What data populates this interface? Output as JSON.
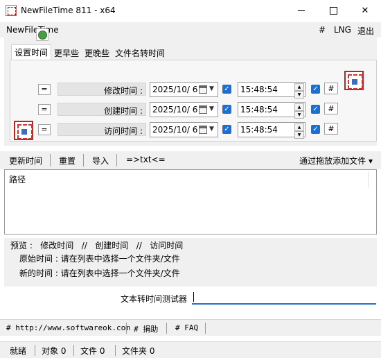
{
  "window": {
    "title": "NewFileTime 811 - x64"
  },
  "menu": {
    "app_name": "NewFileTime",
    "hash": "#",
    "lng": "LNG",
    "exit": "退出"
  },
  "tabs": [
    {
      "label": "设置时间",
      "active": true
    },
    {
      "label": "更早些",
      "active": false
    },
    {
      "label": "更晚些",
      "active": false
    },
    {
      "label": "文件名转时间",
      "active": false
    }
  ],
  "time_rows": [
    {
      "eq": "=",
      "label": "修改时间 :",
      "date": "2025/10/ 6",
      "time": "15:48:54",
      "date_checked": true,
      "time_checked": true,
      "hash": "#"
    },
    {
      "eq": "=",
      "label": "创建时间 :",
      "date": "2025/10/ 6",
      "time": "15:48:54",
      "date_checked": true,
      "time_checked": true,
      "hash": "#"
    },
    {
      "eq": "=",
      "label": "访问时间 :",
      "date": "2025/10/ 6",
      "time": "15:48:54",
      "date_checked": true,
      "time_checked": true,
      "hash": "#"
    }
  ],
  "toolbar": {
    "update": "更新时间",
    "reset": "重置",
    "import": "导入",
    "txt": "=>txt<=",
    "drag_drop": "通过拖放添加文件"
  },
  "list": {
    "header": "路径"
  },
  "preview": {
    "header": "预览 :   修改时间   //   创建时间   //   访问时间",
    "original": "原始时间 : 请在列表中选择一个文件夹/文件",
    "new": "新的时间 : 请在列表中选择一个文件夹/文件"
  },
  "tester": {
    "label": "文本转时间测试器",
    "value": ""
  },
  "links": {
    "site": "# http://www.softwareok.com",
    "donate": "# 捐助",
    "faq": "# FAQ"
  },
  "status": {
    "ready": "就绪",
    "objects": "对象 0",
    "files": "文件 0",
    "folders": "文件夹 0"
  },
  "colors": {
    "accent": "#1f6fcf",
    "panel": "#f0f0f0"
  }
}
